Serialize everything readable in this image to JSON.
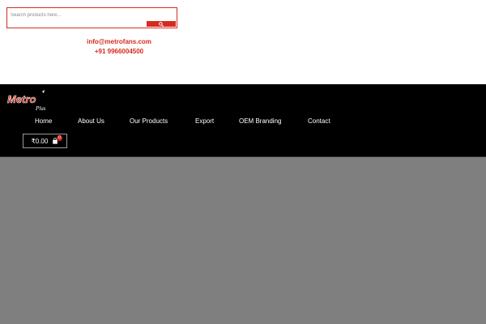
{
  "search": {
    "placeholder": "Search products here..."
  },
  "contact": {
    "email": "info@metrofans.com",
    "phone": "+91 9966004500"
  },
  "logo": {
    "text": "Metro",
    "subtext": "Plus"
  },
  "nav": {
    "items": [
      {
        "label": "Home"
      },
      {
        "label": "About Us"
      },
      {
        "label": "Our Products"
      },
      {
        "label": "Export"
      },
      {
        "label": "OEM Branding"
      },
      {
        "label": "Contact"
      }
    ]
  },
  "cart": {
    "total": "₹0.00",
    "count": "0"
  },
  "icons": {
    "search": "search-icon",
    "cart": "shopping-bag-icon"
  },
  "colors": {
    "brand": "#d52b1e",
    "header_bg": "#000000",
    "hero_bg": "#7f7f7f"
  }
}
